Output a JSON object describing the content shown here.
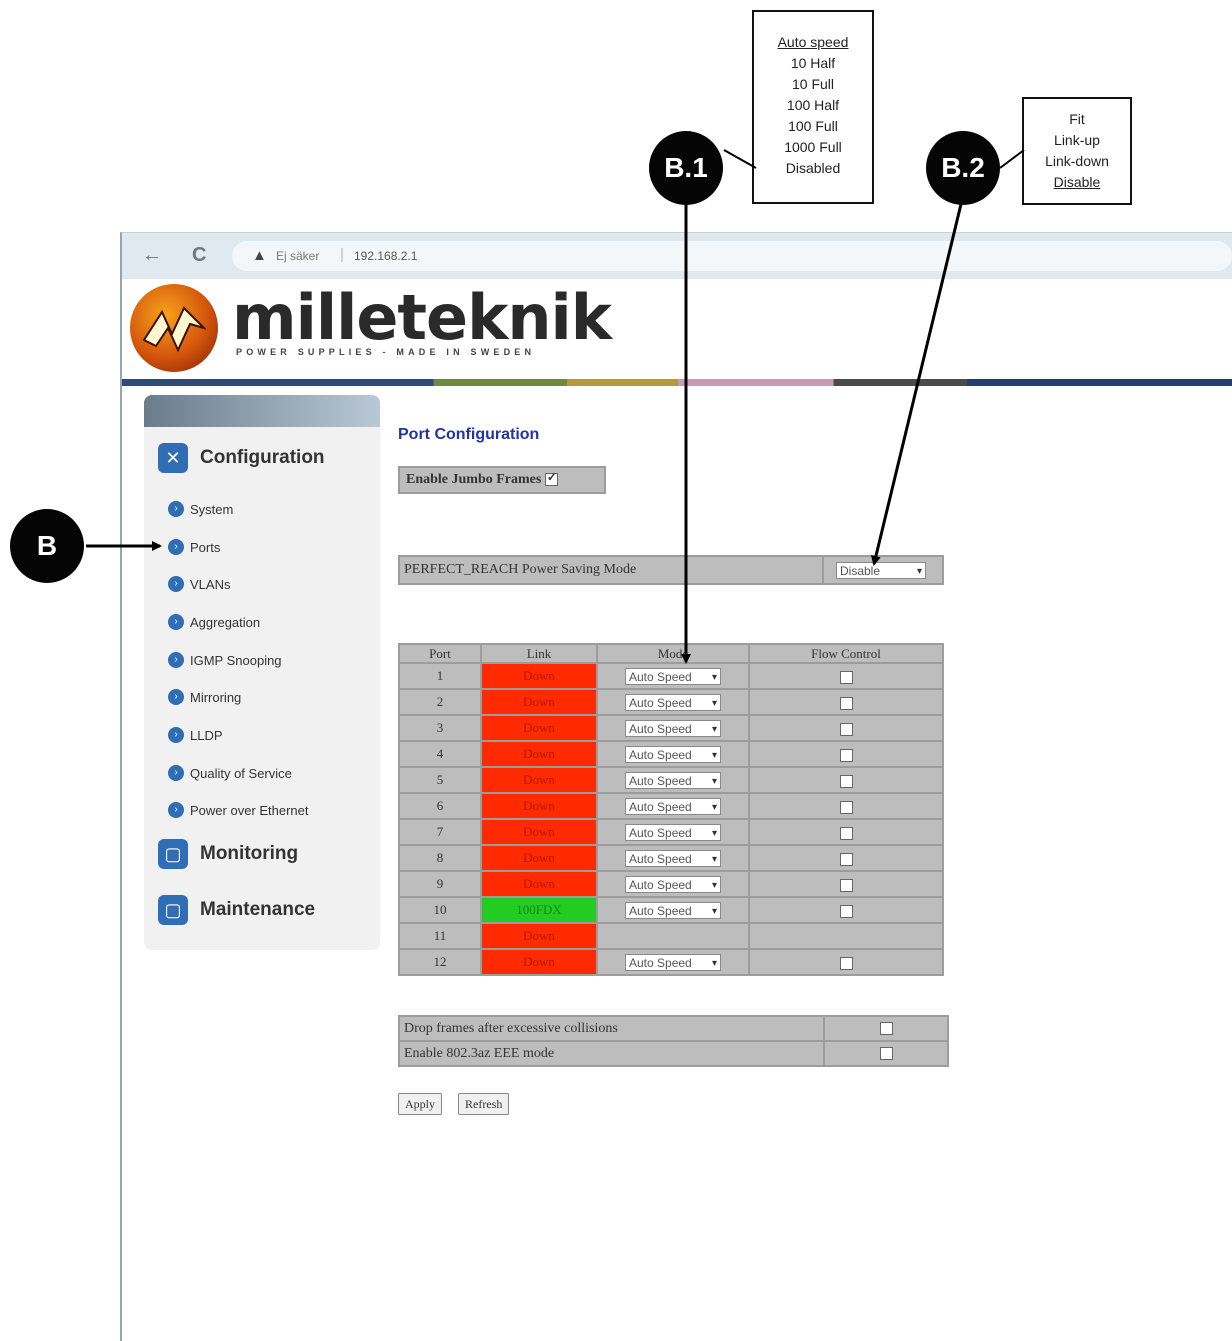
{
  "browser": {
    "back": "←",
    "reload": "C",
    "security_label": "Ej säker",
    "address": "192.168.2.1"
  },
  "logo": {
    "name": "milleteknik",
    "tagline": "POWER SUPPLIES - MADE IN SWEDEN"
  },
  "sidebar": {
    "configuration": "Configuration",
    "items": [
      {
        "label": "System"
      },
      {
        "label": "Ports"
      },
      {
        "label": "VLANs"
      },
      {
        "label": "Aggregation"
      },
      {
        "label": "IGMP Snooping"
      },
      {
        "label": "Mirroring"
      },
      {
        "label": "LLDP"
      },
      {
        "label": "Quality of Service"
      },
      {
        "label": "Power over Ethernet"
      }
    ],
    "monitoring": "Monitoring",
    "maintenance": "Maintenance"
  },
  "main": {
    "title": "Port Configuration",
    "jumbo_label": "Enable Jumbo Frames",
    "psm_label": "PERFECT_REACH Power Saving Mode",
    "psm_value": "Disable",
    "table": {
      "headers": [
        "Port",
        "Link",
        "Mode",
        "Flow Control"
      ],
      "rows": [
        {
          "port": "1",
          "link": "Down",
          "mode": "Auto Speed"
        },
        {
          "port": "2",
          "link": "Down",
          "mode": "Auto Speed"
        },
        {
          "port": "3",
          "link": "Down",
          "mode": "Auto Speed"
        },
        {
          "port": "4",
          "link": "Down",
          "mode": "Auto Speed"
        },
        {
          "port": "5",
          "link": "Down",
          "mode": "Auto Speed"
        },
        {
          "port": "6",
          "link": "Down",
          "mode": "Auto Speed"
        },
        {
          "port": "7",
          "link": "Down",
          "mode": "Auto Speed"
        },
        {
          "port": "8",
          "link": "Down",
          "mode": "Auto Speed"
        },
        {
          "port": "9",
          "link": "Down",
          "mode": "Auto Speed"
        },
        {
          "port": "10",
          "link": "100FDX",
          "mode": "Auto Speed"
        },
        {
          "port": "11",
          "link": "Down",
          "mode": ""
        },
        {
          "port": "12",
          "link": "Down",
          "mode": "Auto Speed"
        }
      ]
    },
    "drop_frames_label": "Drop frames after excessive collisions",
    "eee_label": "Enable 802.3az EEE mode",
    "apply": "Apply",
    "refresh": "Refresh"
  },
  "annotations": {
    "badge_b": "B",
    "badge_b1": "B.1",
    "badge_b2": "B.2",
    "mode_options": [
      "Auto speed",
      "10 Half",
      "10 Full",
      "100 Half",
      "100 Full",
      "1000 Full",
      "Disabled"
    ],
    "psm_options": [
      "Fit",
      "Link-up",
      "Link-down",
      "Disable"
    ]
  },
  "colors": {
    "link_down": "#ff2a00",
    "link_up": "#22cc22",
    "title": "#2433a6",
    "accent": "#2f6db5"
  }
}
